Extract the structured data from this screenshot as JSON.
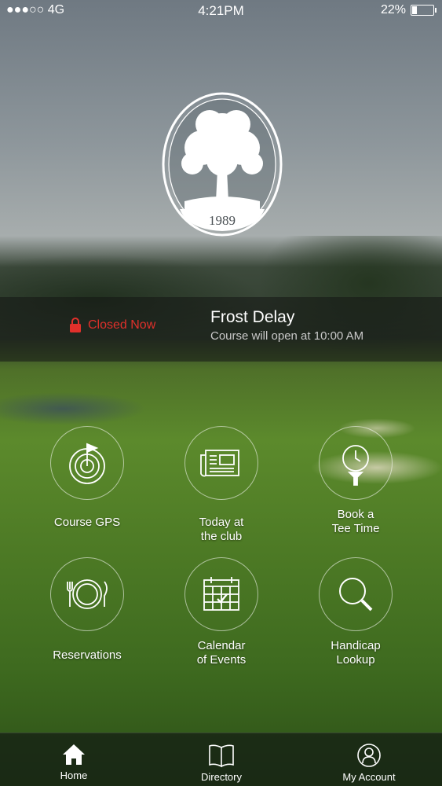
{
  "status_bar": {
    "carrier": "●●●○○ 4G",
    "time": "4:21PM",
    "battery_percent": "22%",
    "battery_level": 0.22
  },
  "logo": {
    "year": "1989",
    "icon": "oak-tree-emblem"
  },
  "status_banner": {
    "closed_label": "Closed Now",
    "title": "Frost Delay",
    "subtitle": "Course will open at 10:00 AM",
    "closed_color": "#e0302b"
  },
  "tiles": [
    {
      "label": "Course GPS",
      "icon": "gps-flag-icon"
    },
    {
      "label_line1": "Today at",
      "label_line2": "the club",
      "icon": "newspaper-icon"
    },
    {
      "label_line1": "Book a",
      "label_line2": "Tee Time",
      "icon": "tee-clock-icon"
    },
    {
      "label": "Reservations",
      "icon": "dining-plate-icon"
    },
    {
      "label_line1": "Calendar",
      "label_line2": "of Events",
      "icon": "calendar-icon"
    },
    {
      "label_line1": "Handicap",
      "label_line2": "Lookup",
      "icon": "magnifier-icon"
    }
  ],
  "tab_bar": [
    {
      "label": "Home",
      "icon": "home-icon",
      "active": true
    },
    {
      "label": "Directory",
      "icon": "book-icon",
      "active": false
    },
    {
      "label": "My Account",
      "icon": "person-icon",
      "active": false
    }
  ]
}
